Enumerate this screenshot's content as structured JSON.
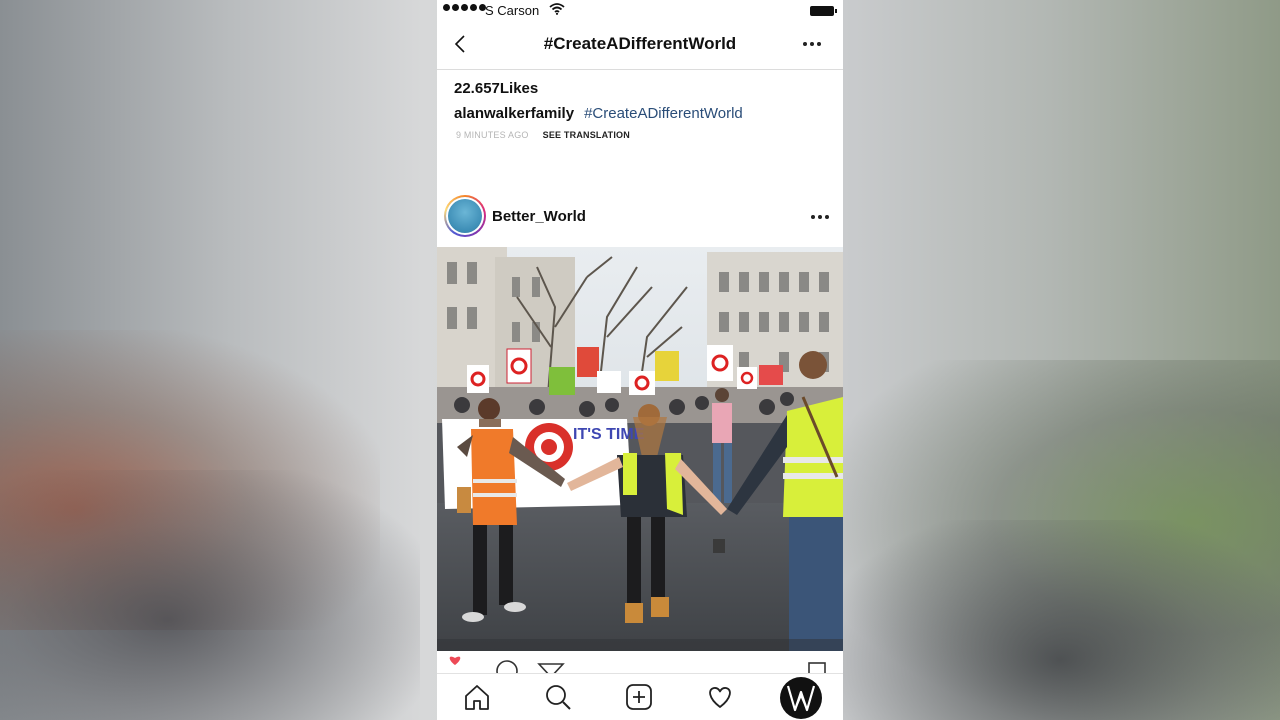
{
  "status_bar": {
    "carrier": "S Carson"
  },
  "nav": {
    "title": "#CreateADifferentWorld"
  },
  "caption_section": {
    "likes": "22.657Likes",
    "username": "alanwalkerfamily",
    "hashtag": "#CreateADifferentWorld",
    "time_ago": "9 MINUTES AGO",
    "see_translation": "SEE TRANSLATION"
  },
  "post": {
    "username": "Better_World"
  },
  "tab_bar": {
    "items": [
      "home-icon",
      "search-icon",
      "add-post-icon",
      "activity-heart-icon",
      "profile-avatar"
    ]
  },
  "colors": {
    "hashtag": "#2a4d78",
    "vest_orange": "#f07a2a",
    "vest_yellow": "#d8ef3a",
    "heart": "#ed4956"
  },
  "photo_signs": {
    "banner_text": "IT'S TIME"
  }
}
